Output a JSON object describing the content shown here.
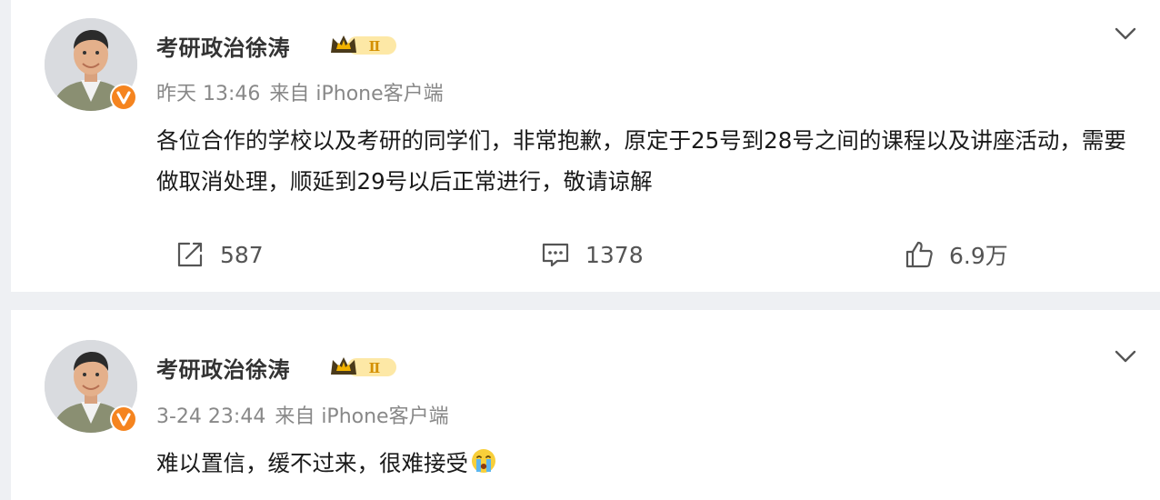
{
  "posts": [
    {
      "author": "考研政治徐涛",
      "level_badge": "Ⅱ",
      "time": "昨天 13:46",
      "source": "来自 iPhone客户端",
      "text": "各位合作的学校以及考研的同学们，非常抱歉，原定于25号到28号之间的课程以及讲座活动，需要做取消处理，顺延到29号以后正常进行，敬请谅解",
      "reposts": "587",
      "comments": "1378",
      "likes": "6.9万"
    },
    {
      "author": "考研政治徐涛",
      "level_badge": "Ⅱ",
      "time": "3-24 23:44",
      "source": "来自 iPhone客户端",
      "text": "难以置信，缓不过来，很难接受"
    }
  ],
  "icons": {
    "verified": "verified-v-icon",
    "crown": "crown-badge-icon",
    "more": "chevron-down-icon",
    "repost": "repost-icon",
    "comment": "comment-icon",
    "like": "thumbs-up-icon",
    "emoji": "crying-face-icon"
  },
  "colors": {
    "verified_orange": "#f5841f",
    "crown_gold": "#f2b200",
    "text_dark": "#1a1a1a",
    "text_meta": "#888888",
    "background": "#eef0f3"
  }
}
